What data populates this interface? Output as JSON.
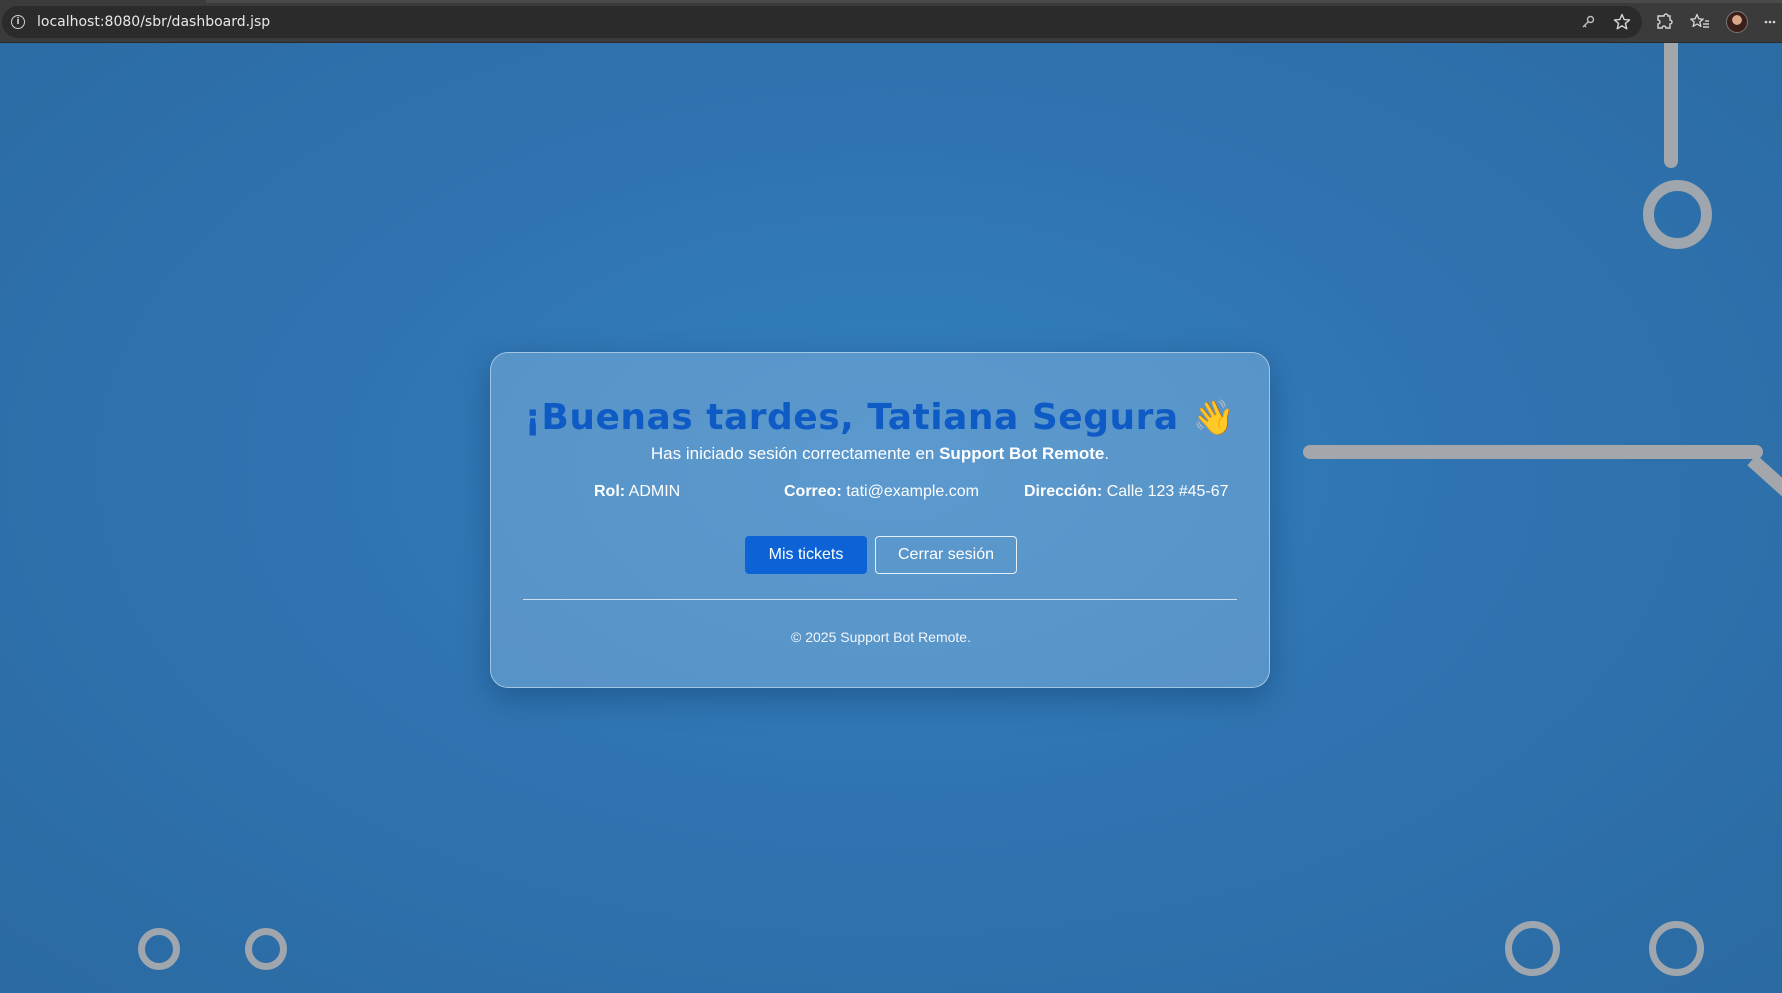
{
  "browser": {
    "url": "localhost:8080/sbr/dashboard.jsp",
    "icons": [
      "info-icon",
      "key-icon",
      "star-icon",
      "extensions-icon",
      "favorites-icon",
      "avatar",
      "more-icon"
    ]
  },
  "card": {
    "greeting": "¡Buenas tardes, Tatiana Segura",
    "greeting_emoji": "👋",
    "subtitle_prefix": "Has iniciado sesión correctamente en ",
    "subtitle_app": "Support Bot Remote",
    "subtitle_suffix": ".",
    "role_label": "Rol:",
    "role_value": "ADMIN",
    "email_label": "Correo:",
    "email_value": "tati@example.com",
    "address_label": "Dirección:",
    "address_value": "Calle 123 #45-67",
    "btn_tickets": "Mis tickets",
    "btn_logout": "Cerrar sesión",
    "footer": "© 2025 Support Bot Remote."
  },
  "colors": {
    "background": "#2f74b1",
    "greeting": "#0f5bc6",
    "primary_button": "#0d63d6",
    "decoration": "#a3a7ab"
  }
}
